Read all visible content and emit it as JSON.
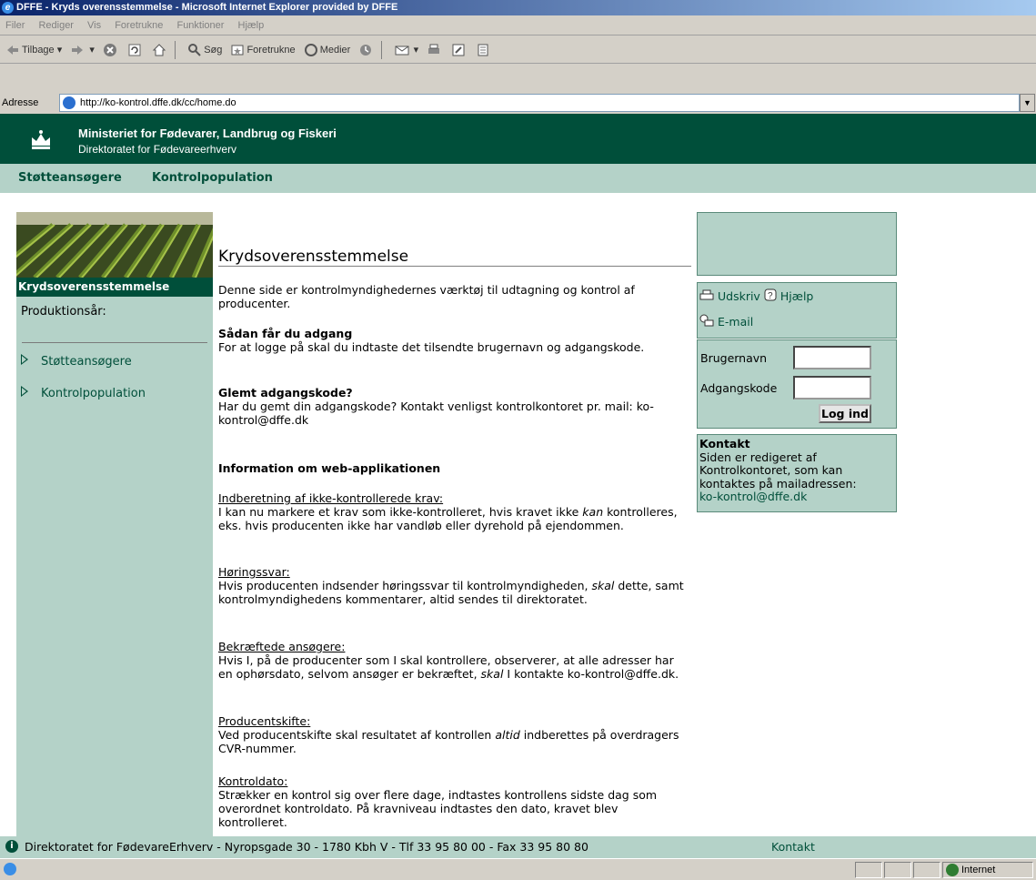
{
  "window": {
    "title": "DFFE - Kryds overensstemmelse - Microsoft Internet Explorer provided by DFFE"
  },
  "menu": [
    "Filer",
    "Rediger",
    "Vis",
    "Foretrukne",
    "Funktioner",
    "Hjælp"
  ],
  "toolbar": {
    "back": "Tilbage",
    "search": "Søg",
    "favorites": "Foretrukne",
    "media": "Medier"
  },
  "address": {
    "label": "Adresse",
    "url": "http://ko-kontrol.dffe.dk/cc/home.do"
  },
  "header": {
    "line1": "Ministeriet for Fødevarer, Landbrug og Fiskeri",
    "line2": "Direktoratet for Fødevareerhverv"
  },
  "topnav": [
    "Støtteansøgere",
    "Kontrolpopulation"
  ],
  "sidebar": {
    "title": "Krydsoverensstemmelse",
    "year_label": "Produktionsår:",
    "links": [
      "Støtteansøgere",
      "Kontrolpopulation"
    ]
  },
  "main": {
    "title": "Krydsoverensstemmelse",
    "intro": "Denne side er kontrolmyndighedernes værktøj til udtagning og kontrol af producenter.",
    "access_heading": "Sådan får du adgang",
    "access_text": "For at logge på skal du indtaste det tilsendte brugernavn og adgangskode.",
    "forgot_heading": "Glemt adgangskode?",
    "forgot_text": "Har du gemt din adgangskode? Kontakt venligst kontrolkontoret pr. mail: ko-kontrol@dffe.dk",
    "info_heading": "Information om web-applikationen",
    "sections": [
      {
        "title": "Indberetning af ikke-kontrollerede krav:",
        "text_a": "I kan nu markere et krav som ikke-kontrolleret, hvis kravet ikke ",
        "em": "kan",
        "text_b": " kontrolleres, eks. hvis producenten ikke har vandløb eller dyrehold på ejendommen."
      },
      {
        "title": "Høringssvar:",
        "text_a": "Hvis producenten indsender høringssvar til kontrolmyndigheden, ",
        "em": "skal",
        "text_b": " dette, samt kontrolmyndighedens kommentarer, altid sendes til direktoratet."
      },
      {
        "title": "Bekræftede ansøgere:",
        "text_a": "Hvis I, på de producenter som I skal kontrollere, observerer, at alle adresser har en ophørsdato, selvom ansøger er bekræftet, ",
        "em": "skal",
        "text_b": " I kontakte ko-kontrol@dffe.dk."
      },
      {
        "title": "Producentskifte:",
        "text_a": "Ved producentskifte skal resultatet af kontrollen ",
        "em": "altid",
        "text_b": " indberettes på overdragers CVR-nummer."
      },
      {
        "title": "Kontroldato:",
        "text_a": "Strækker en kontrol sig over flere dage, indtastes kontrollens sidste dag som overordnet kontroldato. På kravniveau indtastes den dato, kravet blev kontrolleret.",
        "em": "",
        "text_b": ""
      }
    ]
  },
  "tools": {
    "print": "Udskriv",
    "help": "Hjælp",
    "email": "E-mail"
  },
  "login": {
    "username_label": "Brugernavn",
    "password_label": "Adgangskode",
    "button": "Log ind"
  },
  "contact_box": {
    "heading": "Kontakt",
    "text": "Siden er redigeret af Kontrolkontoret, som kan kontaktes på mailadressen:",
    "email": "ko-kontrol@dffe.dk"
  },
  "footer": {
    "text": "Direktoratet for FødevareErhverv - Nyropsgade 30 - 1780 Kbh V - Tlf 33 95 80 00 - Fax 33 95 80 80",
    "link": "Kontakt"
  },
  "statusbar": {
    "zone": "Internet"
  },
  "colors": {
    "header_green": "#004f3a",
    "nav_green": "#b4d2c8"
  }
}
